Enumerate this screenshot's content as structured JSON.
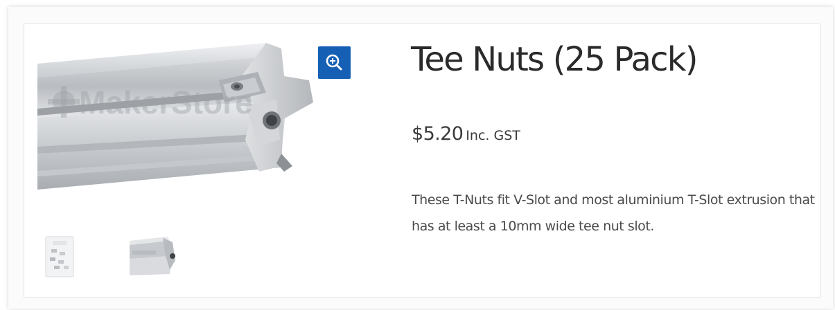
{
  "product": {
    "title": "Tee Nuts (25 Pack)",
    "price": {
      "amount": "$5.20",
      "suffix": "Inc. GST"
    },
    "description": "These T-Nuts fit V-Slot and most aluminium T-Slot extrusion that has at least a 10mm wide tee nut slot."
  },
  "gallery": {
    "watermark": "MakerStore",
    "zoom_icon": "zoom-in-icon",
    "thumbnails": [
      {
        "name": "tee-nuts-pack-photo"
      },
      {
        "name": "extrusion-with-tee-nut-photo"
      }
    ]
  },
  "colors": {
    "accent": "#1560b5",
    "title_text": "#2a2a2a",
    "body_text": "#4a4a4a"
  }
}
